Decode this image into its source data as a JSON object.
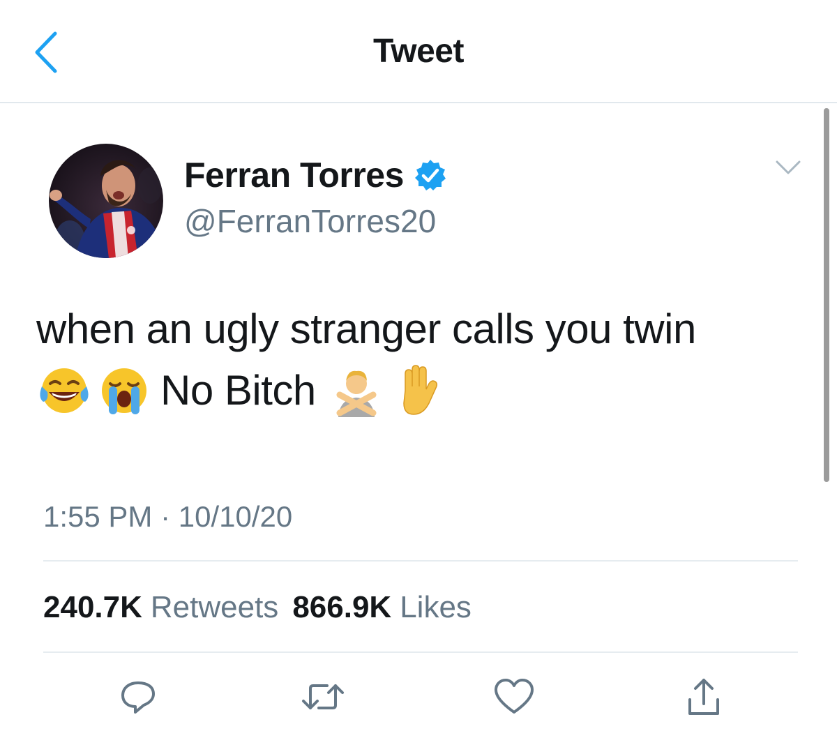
{
  "header": {
    "title": "Tweet",
    "back_icon": "chevron-left-icon",
    "accent_color": "#1da1f2"
  },
  "tweet": {
    "author": {
      "display_name": "Ferran Torres",
      "handle": "@FerranTorres20",
      "verified_icon": "verified-badge-icon"
    },
    "menu_icon": "chevron-down-icon",
    "text_line1": "when an ugly stranger calls you twin",
    "text_line2": "No Bitch",
    "emojis_before": [
      "face-with-tears-of-joy-icon",
      "loudly-crying-face-icon"
    ],
    "emojis_after": [
      "person-gesturing-no-icon",
      "raised-hand-icon"
    ],
    "timestamp": "1:55 PM · 10/10/20",
    "stats": {
      "retweets_count": "240.7K",
      "retweets_label": "Retweets",
      "likes_count": "866.9K",
      "likes_label": "Likes"
    },
    "actions": [
      "reply-icon",
      "retweet-icon",
      "like-icon",
      "share-icon"
    ]
  },
  "colors": {
    "text_primary": "#14171a",
    "text_secondary": "#657786",
    "verified_blue": "#1da1f2",
    "action_gray": "#657786"
  }
}
